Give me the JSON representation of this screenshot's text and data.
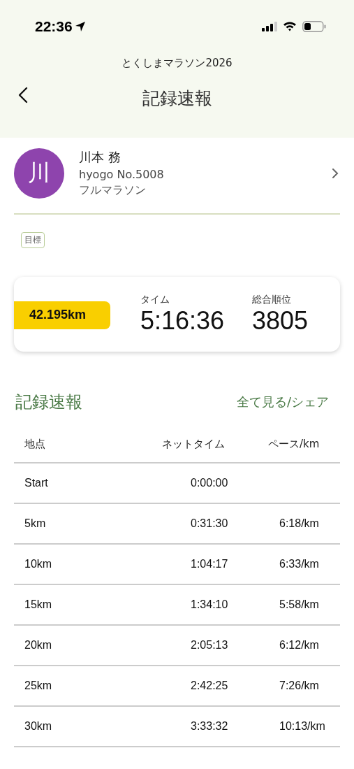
{
  "status_bar": {
    "time": "22:36"
  },
  "header": {
    "event": "とくしまマラソン2026",
    "title": "記録速報"
  },
  "runner": {
    "avatar": "川",
    "name": "川本 務",
    "bib": "hyogo No.5008",
    "category": "フルマラソン"
  },
  "goal_tag": "目標",
  "result": {
    "distance": "42.195km",
    "time_label": "タイム",
    "time": "5:16:36",
    "rank_label": "総合順位",
    "rank": "3805"
  },
  "splits": {
    "title": "記録速報",
    "link": "全て見る/シェア",
    "columns": [
      "地点",
      "ネットタイム",
      "ペース/km"
    ],
    "rows": [
      {
        "point": "Start",
        "net_time": "0:00:00"
      },
      {
        "point": "5km",
        "net_time": "0:31:30",
        "pace": "6:18/km"
      },
      {
        "point": "10km",
        "net_time": "1:04:17",
        "pace": "6:33/km"
      },
      {
        "point": "15km",
        "net_time": "1:34:10",
        "pace": "5:58/km"
      },
      {
        "point": "20km",
        "net_time": "2:05:13",
        "pace": "6:12/km"
      },
      {
        "point": "25km",
        "net_time": "2:42:25",
        "pace": "7:26/km"
      },
      {
        "point": "30km",
        "net_time": "3:33:32",
        "pace": "10:13/km"
      }
    ]
  }
}
